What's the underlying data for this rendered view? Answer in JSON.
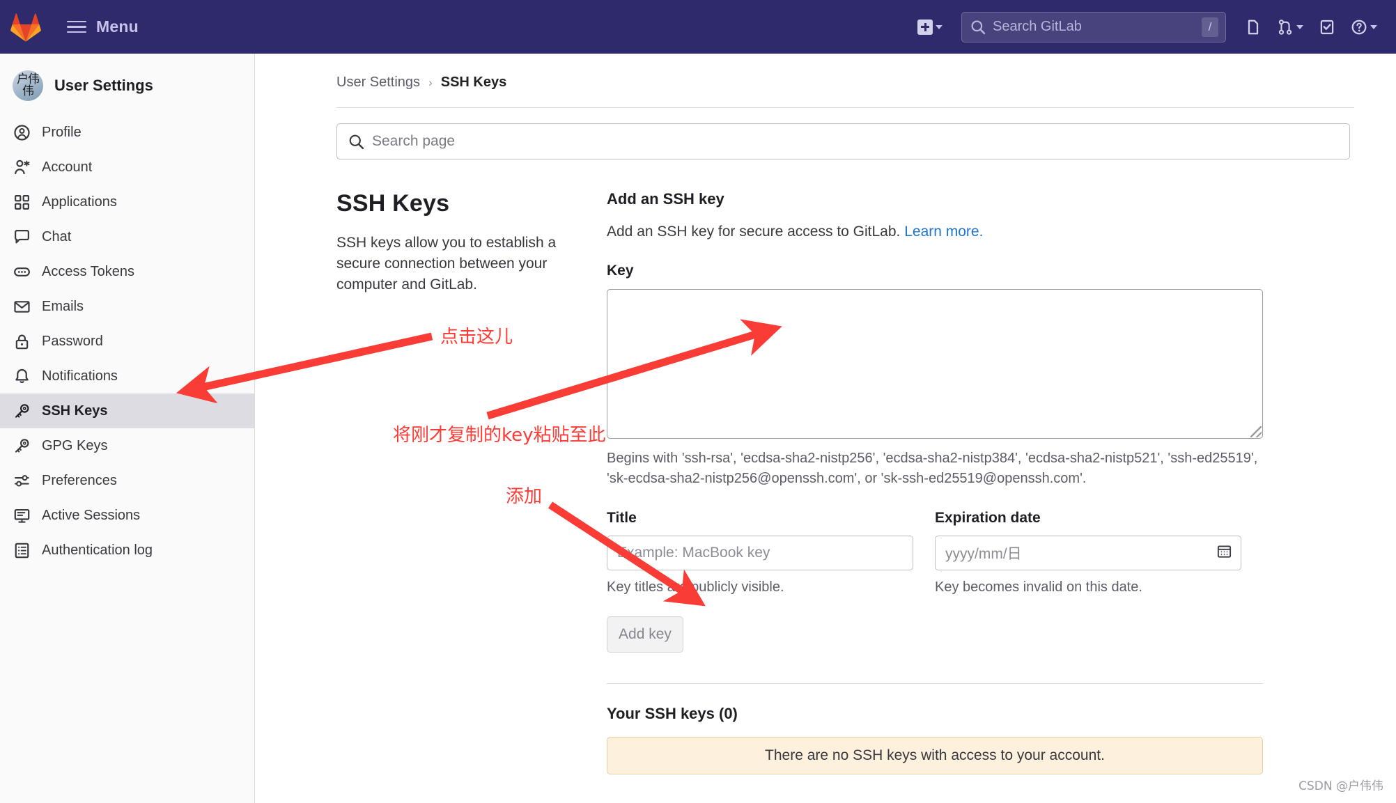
{
  "topnav": {
    "menu_label": "Menu",
    "logo_name": "gitlab-logo",
    "create_new_label": "create-new",
    "search_placeholder": "Search GitLab",
    "search_shortcut": "/",
    "icons": [
      "plus-square-icon",
      "chevron-down-icon",
      "search-icon",
      "issues-icon",
      "merge-requests-icon",
      "todos-icon",
      "help-icon"
    ],
    "brand_color": "#2f2a6b"
  },
  "sidebar": {
    "title": "User Settings",
    "avatar_text": "户伟伟",
    "items": [
      {
        "label": "Profile",
        "icon": "user-circle-icon",
        "active": false
      },
      {
        "label": "Account",
        "icon": "account-icon",
        "active": false
      },
      {
        "label": "Applications",
        "icon": "applications-grid-icon",
        "active": false
      },
      {
        "label": "Chat",
        "icon": "chat-bubble-icon",
        "active": false
      },
      {
        "label": "Access Tokens",
        "icon": "token-icon",
        "active": false
      },
      {
        "label": "Emails",
        "icon": "envelope-icon",
        "active": false
      },
      {
        "label": "Password",
        "icon": "lock-icon",
        "active": false
      },
      {
        "label": "Notifications",
        "icon": "bell-icon",
        "active": false
      },
      {
        "label": "SSH Keys",
        "icon": "key-icon",
        "active": true
      },
      {
        "label": "GPG Keys",
        "icon": "key-icon",
        "active": false
      },
      {
        "label": "Preferences",
        "icon": "sliders-icon",
        "active": false
      },
      {
        "label": "Active Sessions",
        "icon": "monitor-icon",
        "active": false
      },
      {
        "label": "Authentication log",
        "icon": "log-list-icon",
        "active": false
      }
    ]
  },
  "breadcrumb": {
    "parent": "User Settings",
    "separator": "›",
    "current": "SSH Keys"
  },
  "page_search": {
    "placeholder": "Search page",
    "icon": "search-icon"
  },
  "left_panel": {
    "heading": "SSH Keys",
    "description": "SSH keys allow you to establish a secure connection between your computer and GitLab."
  },
  "add_key": {
    "heading": "Add an SSH key",
    "description": "Add an SSH key for secure access to GitLab.",
    "learn_more": "Learn more.",
    "key_label": "Key",
    "key_value": "",
    "key_hint": "Begins with 'ssh-rsa', 'ecdsa-sha2-nistp256', 'ecdsa-sha2-nistp384', 'ecdsa-sha2-nistp521', 'ssh-ed25519', 'sk-ecdsa-sha2-nistp256@openssh.com', or 'sk-ssh-ed25519@openssh.com'.",
    "title_label": "Title",
    "title_placeholder": "Example: MacBook key",
    "title_help": "Key titles are publicly visible.",
    "expiration_label": "Expiration date",
    "expiration_placeholder": "yyyy/mm/日",
    "expiration_help": "Key becomes invalid on this date.",
    "submit_label": "Add key",
    "calendar_icon": "calendar-icon"
  },
  "your_keys": {
    "heading": "Your SSH keys (0)",
    "empty_message": "There are no SSH keys with access to your account."
  },
  "annotations": {
    "color": "#ff3b35",
    "click_here": "点击这儿",
    "paste_key": "将刚才复制的key粘贴至此",
    "add": "添加"
  },
  "watermark": "CSDN @户伟伟"
}
